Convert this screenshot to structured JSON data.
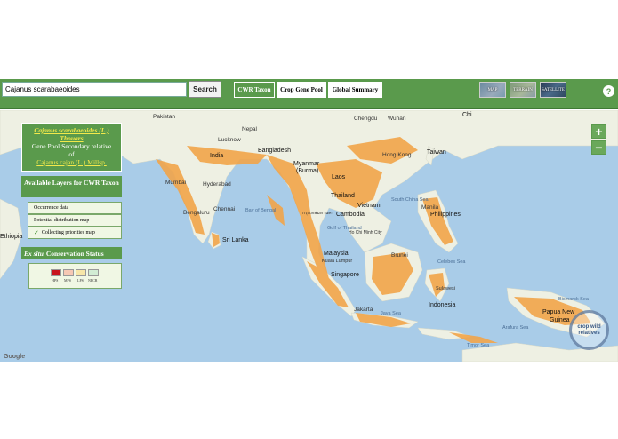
{
  "search": {
    "value": "Cajanus scarabaeoides",
    "button": "Search"
  },
  "tabs": {
    "cwr": "CWR Taxon",
    "gene_pool": "Crop Gene Pool",
    "global": "Global Summary"
  },
  "map_types": {
    "map": "MAP",
    "terrain": "TERRAIN",
    "satellite": "SATELLITE"
  },
  "help": "?",
  "panel": {
    "taxon": "Cajanus scarabaeoides (L.) Thouars",
    "relation_line1": "Gene Pool Secondary relative",
    "relation_line2": "of",
    "crop": "Cajanus cajan (L.) Millsp.",
    "layers_heading": "Available Layers for CWR Taxon",
    "layers": [
      {
        "label": "Occurrence data",
        "checked": false
      },
      {
        "label": "Potential distribution map",
        "checked": false
      },
      {
        "label": "Collecting priorities map",
        "checked": true
      }
    ],
    "status_heading_italic": "Ex situ",
    "status_heading_rest": "Conservation Status",
    "legend": [
      {
        "code": "HPS",
        "color": "#c8141e"
      },
      {
        "code": "MPS",
        "color": "#f6c8b4"
      },
      {
        "code": "LPS",
        "color": "#f7e6a8"
      },
      {
        "code": "NFCR",
        "color": "#d2ecd4"
      }
    ]
  },
  "map_labels": {
    "pakistan": "Pakistan",
    "nepal": "Nepal",
    "lucknow": "Lucknow",
    "india": "India",
    "bangladesh": "Bangladesh",
    "myanmar": "Myanmar",
    "burma": "(Burma)",
    "mumbai": "Mumbai",
    "hyderabad": "Hyderabad",
    "bengaluru": "Bengaluru",
    "chennai": "Chennai",
    "bay": "Bay of Bengal",
    "sri_lanka": "Sri Lanka",
    "thailand": "Thailand",
    "laos": "Laos",
    "vietnam": "Vietnam",
    "cambodia": "Cambodia",
    "bangkok": "กรุงเทพมหานคร",
    "ho_chi_minh": "Ho Chi Minh City",
    "gulf": "Gulf of Thailand",
    "south_china_sea": "South China Sea",
    "philippines": "Philippines",
    "taiwan": "Taiwan",
    "hong_kong": "Hong Kong",
    "manila": "Manila",
    "malaysia": "Malaysia",
    "kuala_lumpur": "Kuala Lumpur",
    "singapore": "Singapore",
    "indonesia": "Indonesia",
    "jakarta": "Jakarta",
    "java_sea": "Java Sea",
    "papua": "Papua New",
    "guinea": "Guinea",
    "bismarck": "Bismarck Sea",
    "arafura": "Arafura Sea",
    "timor": "Timor Sea",
    "ethiopia": "Ethiopia",
    "chengdu": "Chengdu",
    "wuhan": "Wuhan",
    "china": "Chi",
    "celebes": "Celebes Sea",
    "brunei": "Brunei",
    "sulawesi": "Sulawesi"
  },
  "logo_text": "crop wild relatives",
  "google": "Google",
  "colors": {
    "header_green": "#5a9a4c",
    "water": "#a9cce8",
    "land": "#eef0e3",
    "distribution": "#f2a54a"
  }
}
